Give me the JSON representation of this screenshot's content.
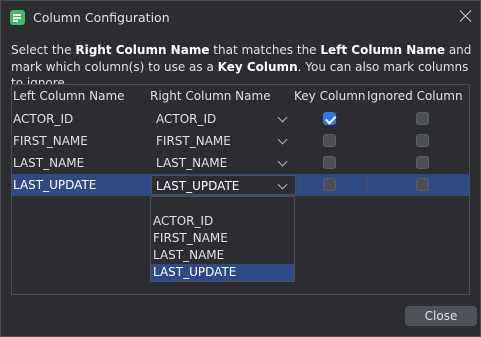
{
  "window": {
    "title": "Column Configuration"
  },
  "description": {
    "p1": "Select the ",
    "b1": "Right Column Name",
    "p2": " that matches the ",
    "b2": "Left Column Name",
    "p3": " and mark which column(s) to use as a ",
    "b3": "Key Column",
    "p4": ". You can also mark columns to ignore."
  },
  "table": {
    "headers": [
      "Left Column Name",
      "Right Column Name",
      "Key Column",
      "Ignored Column"
    ],
    "rows": [
      {
        "left": "ACTOR_ID",
        "right": "ACTOR_ID",
        "key": true,
        "ignored": false
      },
      {
        "left": "FIRST_NAME",
        "right": "FIRST_NAME",
        "key": false,
        "ignored": false
      },
      {
        "left": "LAST_NAME",
        "right": "LAST_NAME",
        "key": false,
        "ignored": false
      },
      {
        "left": "LAST_UPDATE",
        "right": "LAST_UPDATE",
        "key": false,
        "ignored": false
      }
    ],
    "selected_row": 3
  },
  "dropdown": {
    "options": [
      "ACTOR_ID",
      "FIRST_NAME",
      "LAST_NAME",
      "LAST_UPDATE"
    ],
    "selected": "LAST_UPDATE"
  },
  "buttons": {
    "close": "Close"
  },
  "colors": {
    "selection": "#2e4a85",
    "accent": "#3574f0",
    "background": "#2b2d30"
  }
}
